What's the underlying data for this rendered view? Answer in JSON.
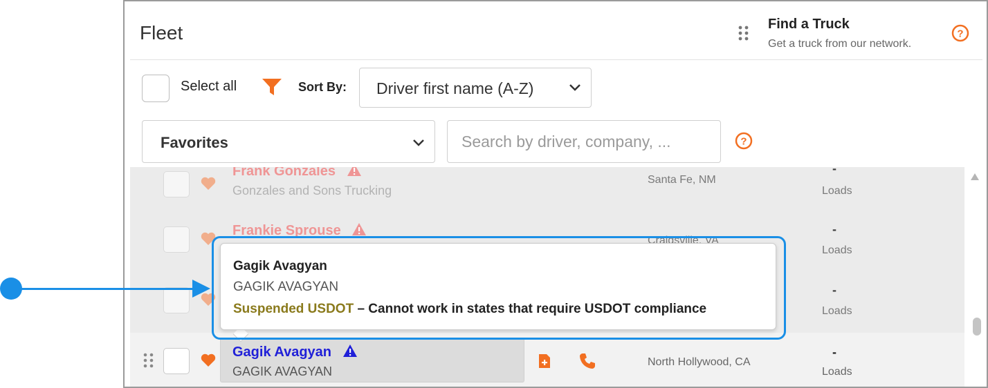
{
  "header": {
    "title": "Fleet",
    "find_truck_title": "Find a Truck",
    "find_truck_subtitle": "Get a truck from our network."
  },
  "toolbar": {
    "select_all_label": "Select all",
    "sort_label": "Sort By:",
    "sort_value": "Driver first name (A-Z)",
    "filter_value": "Favorites",
    "search_placeholder": "Search by driver, company, ..."
  },
  "drivers": [
    {
      "name": "Frank Gonzales",
      "company": "Gonzales and Sons Trucking",
      "location": "Santa Fe, NM",
      "loads_value": "-",
      "loads_label": "Loads"
    },
    {
      "name": "Frankie Sprouse",
      "company": "",
      "location": "Craigsville, VA",
      "loads_value": "-",
      "loads_label": "Loads"
    },
    {
      "name": "",
      "company": "",
      "location": "",
      "loads_value": "-",
      "loads_label": "Loads"
    },
    {
      "name": "Gagik Avagyan",
      "company": "GAGIK AVAGYAN",
      "location": "North Hollywood, CA",
      "loads_value": "-",
      "loads_label": "Loads"
    }
  ],
  "popup": {
    "name": "Gagik Avagyan",
    "company": "GAGIK AVAGYAN",
    "status": "Suspended USDOT",
    "message": " – Cannot work in states that require USDOT compliance"
  },
  "colors": {
    "accent": "#f26f21",
    "callout": "#1a8fe6",
    "driver_link": "#2020d8",
    "status_suspended": "#8a7a1c"
  },
  "icons": [
    "grip-icon",
    "help-icon",
    "filter-icon",
    "chevron-down-icon",
    "heart-icon",
    "warning-icon",
    "document-icon",
    "phone-icon",
    "scroll-up-icon"
  ]
}
